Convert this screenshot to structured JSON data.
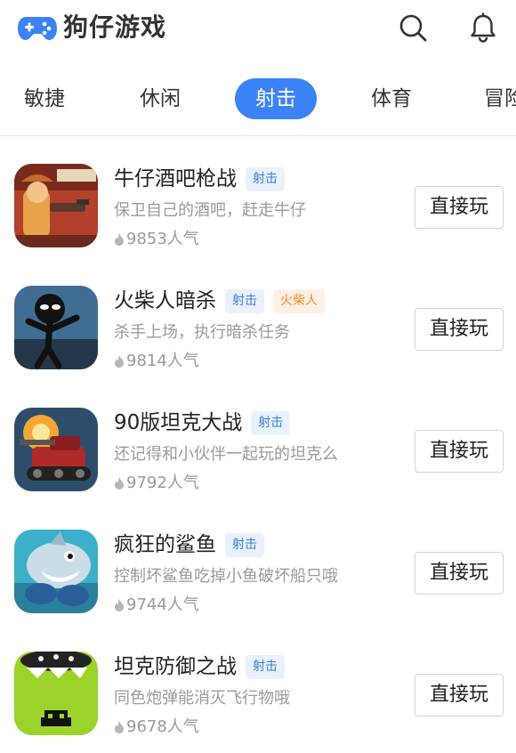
{
  "header": {
    "brand": "狗仔游戏",
    "brand_color": "#3b82f6",
    "icons": {
      "logo": "gamepad-logo",
      "search": "search-icon",
      "notifications": "bell-icon"
    }
  },
  "tabs": [
    {
      "label": "敏捷",
      "active": false
    },
    {
      "label": "休闲",
      "active": false
    },
    {
      "label": "射击",
      "active": true
    },
    {
      "label": "体育",
      "active": false
    },
    {
      "label": "冒险",
      "active": false
    }
  ],
  "games": [
    {
      "title": "牛仔酒吧枪战",
      "tags": [
        {
          "label": "射击",
          "color": "blue"
        }
      ],
      "desc": "保卫自己的酒吧，赶走牛仔",
      "popularity": "9853人气",
      "play_label": "直接玩"
    },
    {
      "title": "火柴人暗杀",
      "tags": [
        {
          "label": "射击",
          "color": "blue"
        },
        {
          "label": "火柴人",
          "color": "orange"
        }
      ],
      "desc": "杀手上场，执行暗杀任务",
      "popularity": "9814人气",
      "play_label": "直接玩"
    },
    {
      "title": "90版坦克大战",
      "tags": [
        {
          "label": "射击",
          "color": "blue"
        }
      ],
      "desc": "还记得和小伙伴一起玩的坦克么",
      "popularity": "9792人气",
      "play_label": "直接玩"
    },
    {
      "title": "疯狂的鲨鱼",
      "tags": [
        {
          "label": "射击",
          "color": "blue"
        }
      ],
      "desc": "控制坏鲨鱼吃掉小鱼破坏船只哦",
      "popularity": "9744人气",
      "play_label": "直接玩"
    },
    {
      "title": "坦克防御之战",
      "tags": [
        {
          "label": "射击",
          "color": "blue"
        }
      ],
      "desc": "同色炮弹能消灭飞行物哦",
      "popularity": "9678人气",
      "play_label": "直接玩"
    }
  ]
}
